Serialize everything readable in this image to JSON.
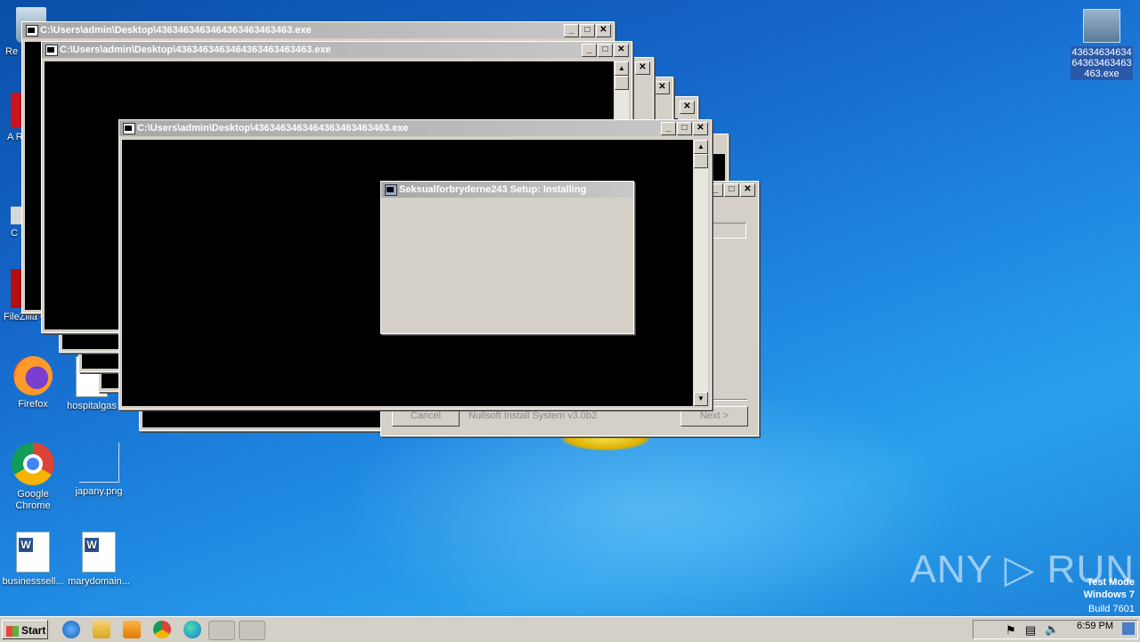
{
  "desktop": {
    "icons": [
      {
        "label": "Re",
        "id": "recycle-bin"
      },
      {
        "label": "A Re",
        "id": "adobe-reader"
      },
      {
        "label": "C",
        "id": "ccleaner"
      },
      {
        "label": "FileZilla C",
        "id": "filezilla"
      },
      {
        "label": "Firefox",
        "id": "firefox"
      },
      {
        "label": "hospitalgas",
        "id": "hospitalgas"
      },
      {
        "label": "Google Chrome",
        "id": "google-chrome"
      },
      {
        "label": "japany.png",
        "id": "japany"
      },
      {
        "label": "businesssell...",
        "id": "businesssell"
      },
      {
        "label": "marydomain...",
        "id": "marydomain"
      }
    ],
    "selected_icon_label": "43634634634\n64363463463\n463.exe"
  },
  "console_windows": {
    "title": "C:\\Users\\admin\\Desktop\\43634634634643634634634634634.exe",
    "title_display": "C:\\Users\\admin\\Desktop\\4363463463464363463463463.exe"
  },
  "installer": {
    "title": "Seksualforbryderne243 Setup: Installing",
    "footer_text": "Nullsoft Install System v3.0b2",
    "cancel_label": "Cancel",
    "next_label": "Next >"
  },
  "titlebar_buttons": {
    "minimize": "_",
    "maximize": "□",
    "close": "✕"
  },
  "taskbar": {
    "start_label": "Start",
    "clock": "6:59 PM"
  },
  "watermark": {
    "brand": "ANY ▷ RUN",
    "line1": "Test Mode",
    "line2": "Windows 7",
    "line3": "Build 7601"
  }
}
